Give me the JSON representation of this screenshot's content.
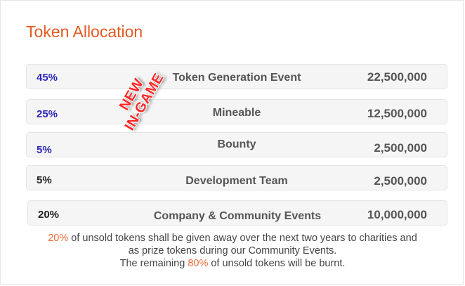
{
  "title": "Token Allocation",
  "stamp": {
    "line1": "NEW",
    "line2": "IN-GAME"
  },
  "rows": [
    {
      "percent": "45%",
      "label": "Token Generation Event",
      "amount": "22,500,000"
    },
    {
      "percent": "25%",
      "label": "Mineable",
      "amount": "12,500,000"
    },
    {
      "percent": "5%",
      "label": "Bounty",
      "amount": "2,500,000"
    },
    {
      "percent": "5%",
      "label": "Development Team",
      "amount": "2,500,000"
    },
    {
      "percent": "20%",
      "label": "Company & Community Events",
      "amount": "10,000,000"
    }
  ],
  "note": {
    "line1_pct": "20%",
    "line1_rest": " of unsold tokens shall be given away over the next two years to charities and",
    "line2": "as prize tokens during our Community Events.",
    "line3_start": "The remaining ",
    "line3_pct": "80%",
    "line3_end": " of unsold tokens will be burnt."
  },
  "colors": {
    "title": "#e35a22",
    "percent_blue": "#2b26b8",
    "stamp": "#ff2a2a",
    "highlight": "#ef6b3c"
  }
}
